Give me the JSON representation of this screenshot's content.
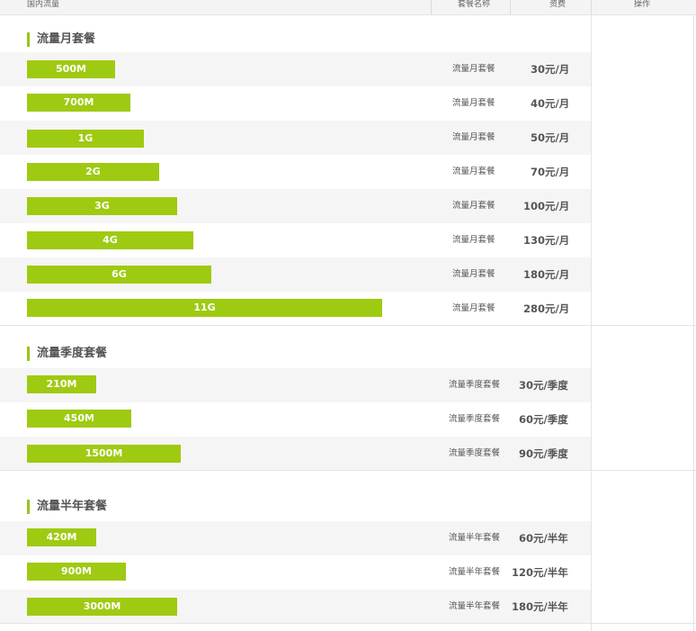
{
  "header": {
    "col_flow": "国内流量",
    "col_name": "套餐名称",
    "col_price": "资费",
    "col_action": "操作"
  },
  "groups": [
    {
      "title": "流量月套餐",
      "rows": [
        {
          "flow": "500M",
          "name": "流量月套餐",
          "price": "30元/月"
        },
        {
          "flow": "700M",
          "name": "流量月套餐",
          "price": "40元/月"
        },
        {
          "flow": "1G",
          "name": "流量月套餐",
          "price": "50元/月"
        },
        {
          "flow": "2G",
          "name": "流量月套餐",
          "price": "70元/月"
        },
        {
          "flow": "3G",
          "name": "流量月套餐",
          "price": "100元/月"
        },
        {
          "flow": "4G",
          "name": "流量月套餐",
          "price": "130元/月"
        },
        {
          "flow": "6G",
          "name": "流量月套餐",
          "price": "180元/月"
        },
        {
          "flow": "11G",
          "name": "流量月套餐",
          "price": "280元/月"
        }
      ]
    },
    {
      "title": "流量季度套餐",
      "rows": [
        {
          "flow": "210M",
          "name": "流量季度套餐",
          "price": "30元/季度"
        },
        {
          "flow": "450M",
          "name": "流量季度套餐",
          "price": "60元/季度"
        },
        {
          "flow": "1500M",
          "name": "流量季度套餐",
          "price": "90元/季度"
        }
      ]
    },
    {
      "title": "流量半年套餐",
      "rows": [
        {
          "flow": "420M",
          "name": "流量半年套餐",
          "price": "60元/半年"
        },
        {
          "flow": "900M",
          "name": "流量半年套餐",
          "price": "120元/半年"
        },
        {
          "flow": "3000M",
          "name": "流量半年套餐",
          "price": "180元/半年"
        }
      ]
    }
  ],
  "colors": {
    "bar": "#9fca12",
    "accent": "#99c31b"
  }
}
